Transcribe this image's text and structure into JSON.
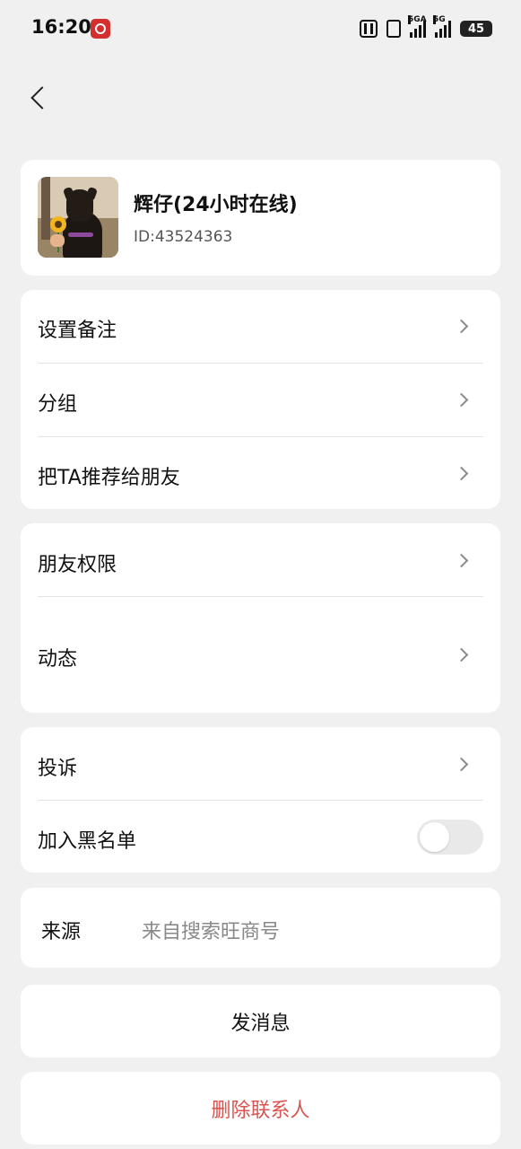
{
  "status_bar": {
    "time": "16:20",
    "signal1_label": "5GA",
    "signal2_label": "5G",
    "battery": "45"
  },
  "profile": {
    "nickname": "辉仔(24小时在线)",
    "id_text": "ID:43524363"
  },
  "menu_group1": {
    "remark": "设置备注",
    "group": "分组",
    "recommend": "把TA推荐给朋友"
  },
  "menu_group2": {
    "permissions": "朋友权限",
    "moments": "动态"
  },
  "menu_group3": {
    "complain": "投诉",
    "blacklist": "加入黑名单",
    "blacklist_enabled": false
  },
  "source": {
    "label": "来源",
    "value": "来自搜索旺商号"
  },
  "actions": {
    "send_message": "发消息",
    "delete_contact": "删除联系人"
  },
  "colors": {
    "delete_text": "#d9534f",
    "page_background": "#f0f0f0"
  }
}
